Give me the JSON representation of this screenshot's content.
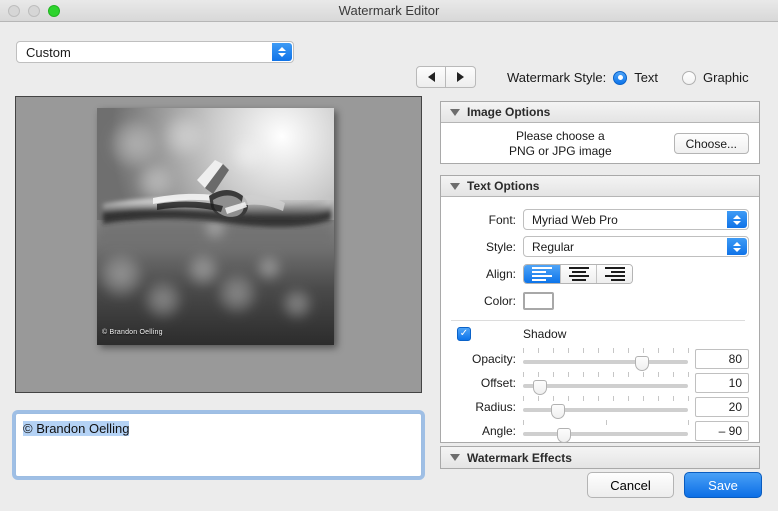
{
  "window": {
    "title": "Watermark Editor",
    "traffic_lights": [
      "close-button",
      "minimize-button",
      "zoom-button"
    ]
  },
  "left": {
    "preset": {
      "value": "Custom",
      "label": "preset-select"
    },
    "preview": {
      "watermark_text": "© Brandon Oelling",
      "image_description": "black-and-white macro photograph of barbed wire with bokeh background"
    },
    "text_input": {
      "value": "© Brandon Oelling",
      "placeholder": ""
    }
  },
  "nav": {
    "prev": "◀",
    "next": "▶"
  },
  "watermark_style": {
    "label": "Watermark Style:",
    "options": [
      {
        "label": "Text",
        "selected": true
      },
      {
        "label": "Graphic",
        "selected": false
      }
    ]
  },
  "image_options": {
    "header": "Image Options",
    "message_line1": "Please choose a",
    "message_line2": "PNG or JPG image",
    "choose_button": "Choose..."
  },
  "text_options": {
    "header": "Text Options",
    "font": {
      "label": "Font:",
      "value": "Myriad Web Pro"
    },
    "style": {
      "label": "Style:",
      "value": "Regular"
    },
    "align": {
      "label": "Align:",
      "options": [
        {
          "name": "align-left",
          "selected": true
        },
        {
          "name": "align-center",
          "selected": false
        },
        {
          "name": "align-right",
          "selected": false
        }
      ]
    },
    "color": {
      "label": "Color:",
      "value": "#ffffff"
    },
    "shadow": {
      "label": "Shadow",
      "checked": true
    },
    "sliders": [
      {
        "label": "Opacity:",
        "value": "80",
        "percent": 72,
        "ticks": 12
      },
      {
        "label": "Offset:",
        "value": "10",
        "percent": 10,
        "ticks": 12
      },
      {
        "label": "Radius:",
        "value": "20",
        "percent": 21,
        "ticks": 12
      },
      {
        "label": "Angle:",
        "value": "– 90",
        "percent": 25,
        "ticks": 3
      }
    ]
  },
  "watermark_effects": {
    "header": "Watermark Effects"
  },
  "footer": {
    "cancel": "Cancel",
    "save": "Save"
  },
  "colors": {
    "accent": "#0d74ea",
    "zoom_light": "#2ed42e",
    "selection": "#b4d2f5"
  }
}
